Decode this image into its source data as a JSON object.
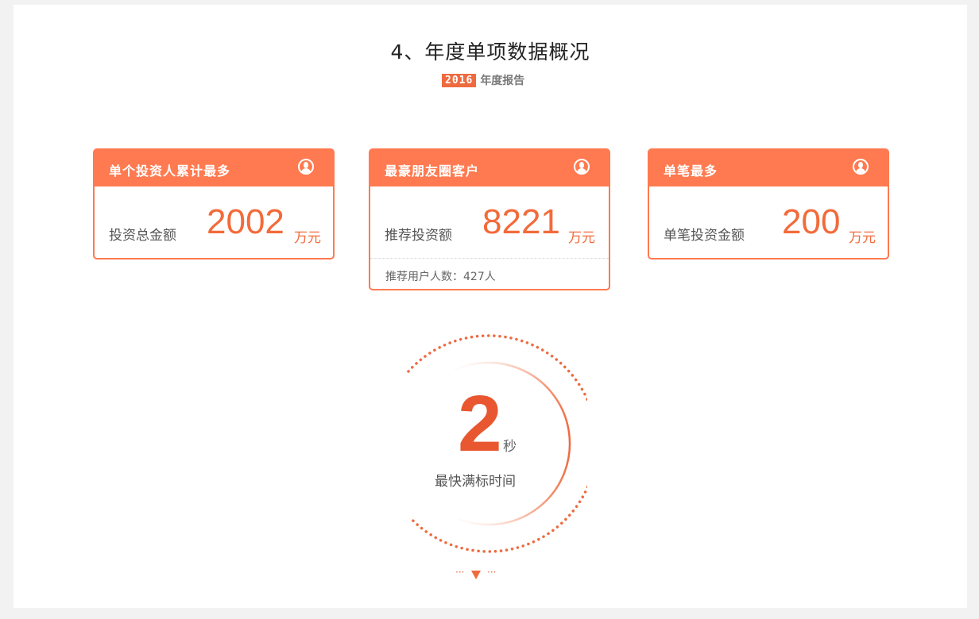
{
  "title": "4、年度单项数据概况",
  "subtitle": {
    "year": "2016",
    "text": "年度报告"
  },
  "cards": [
    {
      "title": "单个投资人累计最多",
      "label": "投资总金额",
      "value": "2002",
      "unit": "万元",
      "icon": "user-icon"
    },
    {
      "title": "最豪朋友圈客户",
      "label": "推荐投资额",
      "value": "8221",
      "unit": "万元",
      "icon": "user-icon",
      "footer": "推荐用户人数：427人"
    },
    {
      "title": "单笔最多",
      "label": "单笔投资金额",
      "value": "200",
      "unit": "万元",
      "icon": "user-icon"
    }
  ],
  "stat": {
    "value": "2",
    "unit": "秒",
    "label": "最快满标时间"
  },
  "more": {
    "left": "···",
    "right": "···",
    "icon": "triangle-down-icon"
  },
  "colors": {
    "accent": "#ff7a50",
    "number": "#f36a3a",
    "background": "#f2f2f2"
  }
}
